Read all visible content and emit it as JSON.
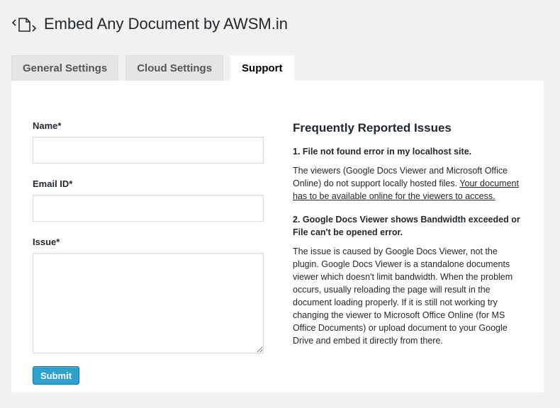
{
  "header": {
    "title": "Embed Any Document by AWSM.in",
    "logo_icon": "document-embed-icon"
  },
  "tabs": [
    {
      "label": "General Settings",
      "active": false
    },
    {
      "label": "Cloud Settings",
      "active": false
    },
    {
      "label": "Support",
      "active": true
    }
  ],
  "form": {
    "name_label": "Name*",
    "name_value": "",
    "email_label": "Email ID*",
    "email_value": "",
    "issue_label": "Issue*",
    "issue_value": "",
    "submit_label": "Submit"
  },
  "faq": {
    "title": "Frequently Reported Issues",
    "q1": "1. File not found error in my localhost site.",
    "a1_text": "The viewers (Google Docs Viewer and Microsoft Office Online) do not support locally hosted files. ",
    "a1_underlined": "Your document has to be available online for the viewers to access.",
    "q2": "2. Google Docs Viewer shows Bandwidth exceeded or File can't be opened error.",
    "a2": "The issue is caused by Google Docs Viewer, not the plugin. Google Docs Viewer is a standalone documents viewer which doesn't limit bandwidth. When the problem occurs, usually reloading the page will result in the document loading properly. If it is still not working try changing the viewer to Microsoft Office Online (for MS Office Documents) or upload document to your Google Drive and embed it directly from there."
  },
  "colors": {
    "accent": "#2ea2cc",
    "background": "#f1f1f1",
    "panel": "#ffffff"
  }
}
